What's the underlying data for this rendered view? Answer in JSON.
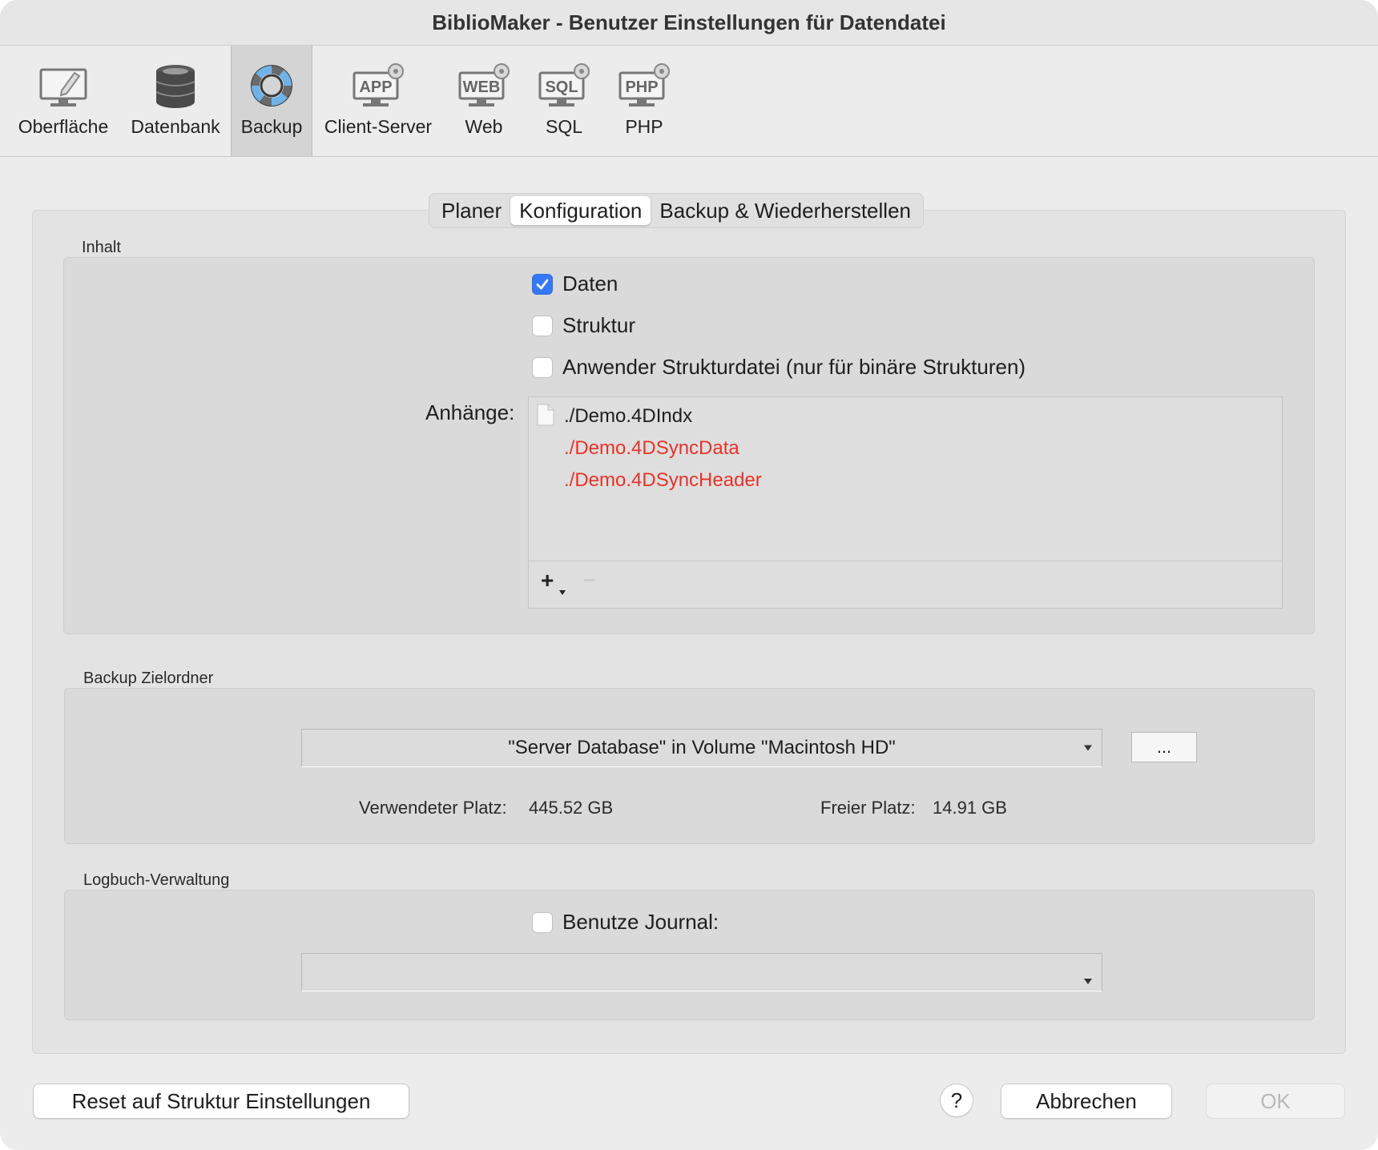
{
  "window": {
    "title": "BiblioMaker - Benutzer Einstellungen für Datendatei"
  },
  "toolbar": {
    "items": [
      {
        "label": "Oberfläche",
        "icon": "monitor-pencil-icon"
      },
      {
        "label": "Datenbank",
        "icon": "database-icon"
      },
      {
        "label": "Backup",
        "icon": "lifebuoy-icon",
        "selected": true
      },
      {
        "label": "Client-Server",
        "icon": "app-server-icon"
      },
      {
        "label": "Web",
        "icon": "web-server-icon"
      },
      {
        "label": "SQL",
        "icon": "sql-server-icon"
      },
      {
        "label": "PHP",
        "icon": "php-server-icon"
      }
    ],
    "badges": {
      "app": "APP",
      "web": "WEB",
      "sql": "SQL",
      "php": "PHP"
    }
  },
  "tabs": {
    "items": [
      {
        "label": "Planer"
      },
      {
        "label": "Konfiguration",
        "selected": true
      },
      {
        "label": "Backup & Wiederherstellen"
      }
    ]
  },
  "inhalt": {
    "label": "Inhalt",
    "checkboxes": [
      {
        "label": "Daten",
        "checked": true
      },
      {
        "label": "Struktur",
        "checked": false
      },
      {
        "label": "Anwender Strukturdatei (nur für binäre Strukturen)",
        "checked": false
      }
    ],
    "attachments_label": "Anhänge:",
    "attachments": [
      {
        "path": "./Demo.4DIndx",
        "color": "#1e1e1e",
        "icon": "file-icon"
      },
      {
        "path": "./Demo.4DSyncData",
        "color": "#e5332a"
      },
      {
        "path": "./Demo.4DSyncHeader",
        "color": "#e5332a"
      }
    ],
    "add_symbol": "+",
    "remove_symbol": "−"
  },
  "zielordner": {
    "label": "Backup Zielordner",
    "destination": "\"Server Database\" in Volume \"Macintosh HD\"",
    "browse_label": "...",
    "used_label": "Verwendeter Platz:",
    "used_value": "445.52 GB",
    "free_label": "Freier Platz:",
    "free_value": "14.91 GB"
  },
  "logbuch": {
    "label": "Logbuch-Verwaltung",
    "journal_label": "Benutze Journal:",
    "journal_checked": false,
    "journal_path": ""
  },
  "footer": {
    "reset_label": "Reset auf Struktur Einstellungen",
    "help_label": "?",
    "cancel_label": "Abbrechen",
    "ok_label": "OK"
  },
  "colors": {
    "accent": "#3478f6",
    "missing_file": "#e5332a",
    "selected_tab_bg": "#d4d4d4"
  }
}
